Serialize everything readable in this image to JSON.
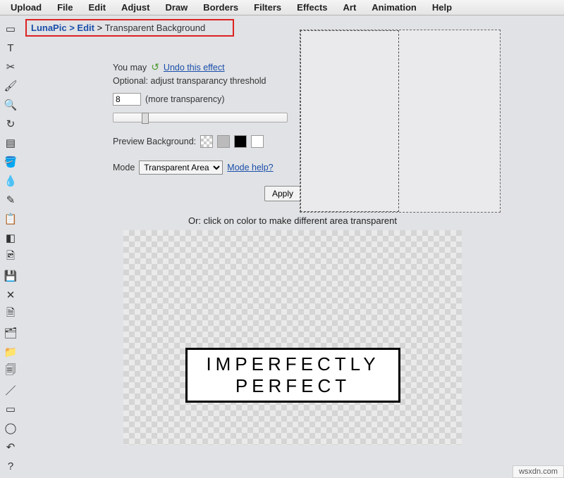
{
  "menu": [
    "Upload",
    "File",
    "Edit",
    "Adjust",
    "Draw",
    "Borders",
    "Filters",
    "Effects",
    "Art",
    "Animation",
    "Help"
  ],
  "tools": [
    "select-rect",
    "text",
    "cut",
    "brush",
    "magnify",
    "rotate",
    "gradient",
    "fill",
    "eyedropper",
    "pencil",
    "copy",
    "eraser",
    "picture",
    "save",
    "close",
    "new-doc",
    "layers",
    "folder",
    "stack",
    "line",
    "rect-shape",
    "ellipse",
    "undo",
    "help"
  ],
  "tool_glyphs": [
    "▭",
    "T",
    "✂",
    "🖌",
    "🔍",
    "↻",
    "▤",
    "🪣",
    "💧",
    "✎",
    "📋",
    "◧",
    "🖻",
    "💾",
    "✕",
    "🗎",
    "🗂",
    "📁",
    "🗐",
    "／",
    "▭",
    "◯",
    "↶",
    "?"
  ],
  "breadcrumb": {
    "home": "LunaPic",
    "edit": "Edit",
    "current": "Transparent Background"
  },
  "panel": {
    "youmay": "You may",
    "undo": "Undo this effect",
    "optional": "Optional: adjust transparancy threshold",
    "value": "8",
    "note": "(more transparency)",
    "previewbg": "Preview Background:",
    "mode_label": "Mode",
    "mode_value": "Transparent Area",
    "mode_help": "Mode help?",
    "apply": "Apply"
  },
  "or_text": "Or: click on color to make different area transparent",
  "logo": {
    "line1": "IMPERFECTLY",
    "line2": "PERFECT"
  },
  "watermark": "wsxdn.com"
}
